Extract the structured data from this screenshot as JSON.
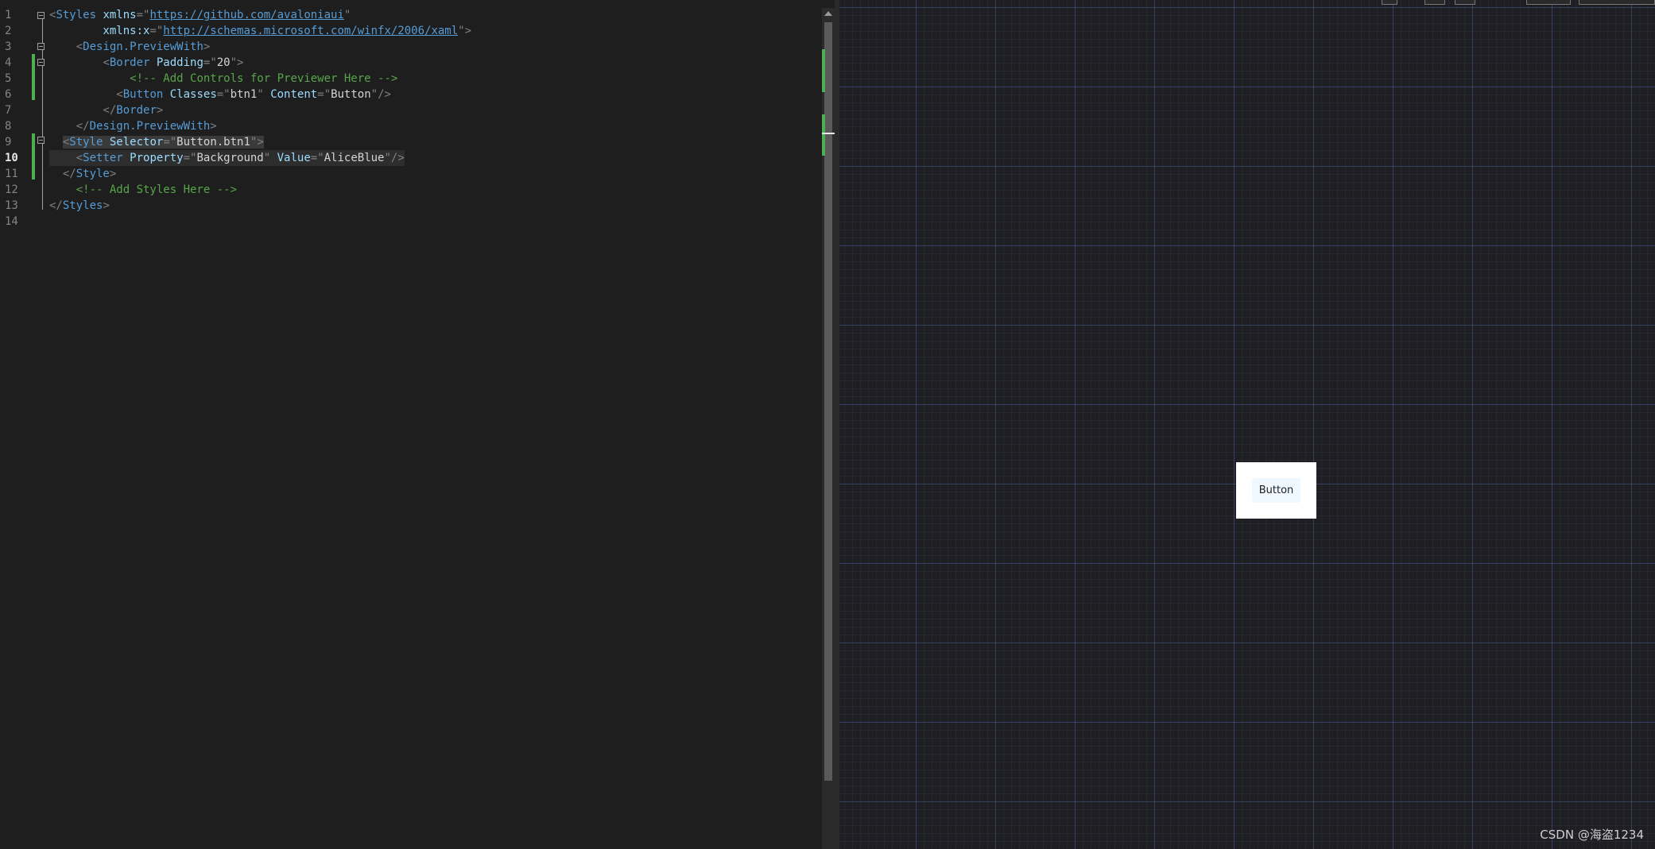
{
  "editor": {
    "line_numbers": [
      "1",
      "2",
      "3",
      "4",
      "5",
      "6",
      "7",
      "8",
      "9",
      "10",
      "11",
      "12",
      "13",
      "14"
    ],
    "current_line": "10",
    "lines": [
      [
        [
          "t-punc",
          "<"
        ],
        [
          "t-tag",
          "Styles"
        ],
        [
          "",
          ""
        ],
        [
          "t-attr",
          " xmlns"
        ],
        [
          "t-punc",
          "=\""
        ],
        [
          "t-link",
          "https://github.com/avaloniaui"
        ],
        [
          "t-punc",
          "\""
        ]
      ],
      [
        [
          "",
          ""
        ],
        [
          "t-attr",
          "        xmlns:x"
        ],
        [
          "t-punc",
          "=\""
        ],
        [
          "t-link",
          "http://schemas.microsoft.com/winfx/2006/xaml"
        ],
        [
          "t-punc",
          "\">"
        ]
      ],
      [
        [
          "",
          "    "
        ],
        [
          "t-punc",
          "<"
        ],
        [
          "t-tag",
          "Design.PreviewWith"
        ],
        [
          "t-punc",
          ">"
        ]
      ],
      [
        [
          "",
          "        "
        ],
        [
          "t-punc",
          "<"
        ],
        [
          "t-tag",
          "Border"
        ],
        [
          "t-attr",
          " Padding"
        ],
        [
          "t-punc",
          "=\""
        ],
        [
          "t-str",
          "20"
        ],
        [
          "t-punc",
          "\">"
        ]
      ],
      [
        [
          "",
          "            "
        ],
        [
          "t-com",
          "<!-- Add Controls for Previewer Here -->"
        ]
      ],
      [
        [
          "",
          "          "
        ],
        [
          "t-punc",
          "<"
        ],
        [
          "t-tag",
          "Button"
        ],
        [
          "t-attr",
          " Classes"
        ],
        [
          "t-punc",
          "=\""
        ],
        [
          "t-str",
          "btn1"
        ],
        [
          "t-punc",
          "\""
        ],
        [
          "t-attr",
          " Content"
        ],
        [
          "t-punc",
          "=\""
        ],
        [
          "t-str",
          "Button"
        ],
        [
          "t-punc",
          "\"/>"
        ]
      ],
      [
        [
          "",
          "        "
        ],
        [
          "t-punc",
          "</"
        ],
        [
          "t-tag",
          "Border"
        ],
        [
          "t-punc",
          ">"
        ]
      ],
      [
        [
          "",
          "    "
        ],
        [
          "t-punc",
          "</"
        ],
        [
          "t-tag",
          "Design.PreviewWith"
        ],
        [
          "t-punc",
          ">"
        ]
      ],
      [
        [
          "",
          "  "
        ],
        [
          "t-punc",
          "<"
        ],
        [
          "t-tag",
          "Style"
        ],
        [
          "t-attr",
          " Selector"
        ],
        [
          "t-punc",
          "=\""
        ],
        [
          "t-str",
          "Button.btn1"
        ],
        [
          "t-punc",
          "\">"
        ]
      ],
      [
        [
          "",
          "    "
        ],
        [
          "t-punc",
          "<"
        ],
        [
          "t-tag",
          "Setter"
        ],
        [
          "t-attr",
          " Property"
        ],
        [
          "t-punc",
          "=\""
        ],
        [
          "t-str",
          "Background"
        ],
        [
          "t-punc",
          "\""
        ],
        [
          "t-attr",
          " Value"
        ],
        [
          "t-punc",
          "=\""
        ],
        [
          "t-str",
          "AliceBlue"
        ],
        [
          "t-punc",
          "\"/>"
        ]
      ],
      [
        [
          "",
          "  "
        ],
        [
          "t-punc",
          "</"
        ],
        [
          "t-tag",
          "Style"
        ],
        [
          "t-punc",
          ">"
        ]
      ],
      [
        [
          "",
          "    "
        ],
        [
          "t-com",
          "<!-- Add Styles Here -->"
        ]
      ],
      [
        [
          "t-punc",
          "</"
        ],
        [
          "t-tag",
          "Styles"
        ],
        [
          "t-punc",
          ">"
        ]
      ],
      [
        [
          "",
          ""
        ]
      ]
    ]
  },
  "preview": {
    "button_label": "Button",
    "button_background": "#F0F8FF",
    "border_background": "#FFFFFF"
  },
  "colors": {
    "change_marker": "#4CAF50",
    "grid_major": "#3a4f8a",
    "editor_bg": "#1e1e1e"
  },
  "watermark": "CSDN @海盗1234"
}
